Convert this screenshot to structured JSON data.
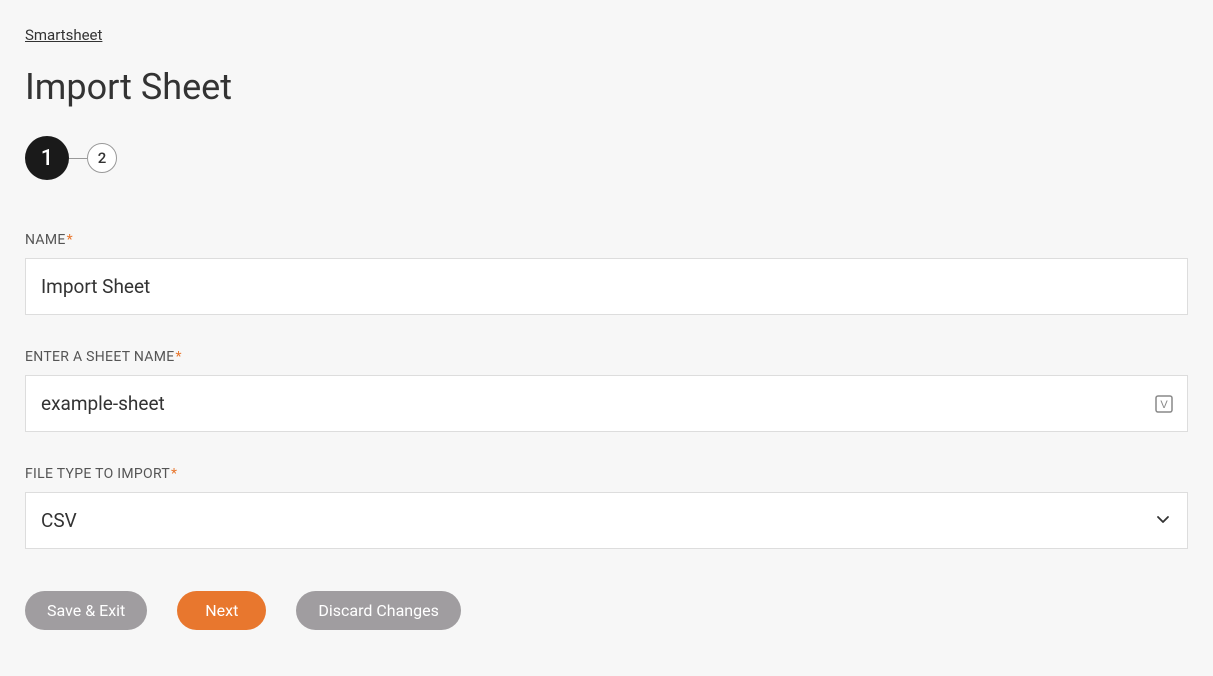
{
  "breadcrumb": {
    "label": "Smartsheet"
  },
  "page": {
    "title": "Import Sheet"
  },
  "stepper": {
    "steps": [
      "1",
      "2"
    ],
    "active": "1"
  },
  "fields": {
    "name": {
      "label": "NAME",
      "value": "Import Sheet"
    },
    "sheet_name": {
      "label": "ENTER A SHEET NAME",
      "value": "example-sheet"
    },
    "file_type": {
      "label": "FILE TYPE TO IMPORT",
      "value": "CSV"
    }
  },
  "buttons": {
    "save_exit": "Save & Exit",
    "next": "Next",
    "discard": "Discard Changes"
  },
  "required_indicator": "*"
}
